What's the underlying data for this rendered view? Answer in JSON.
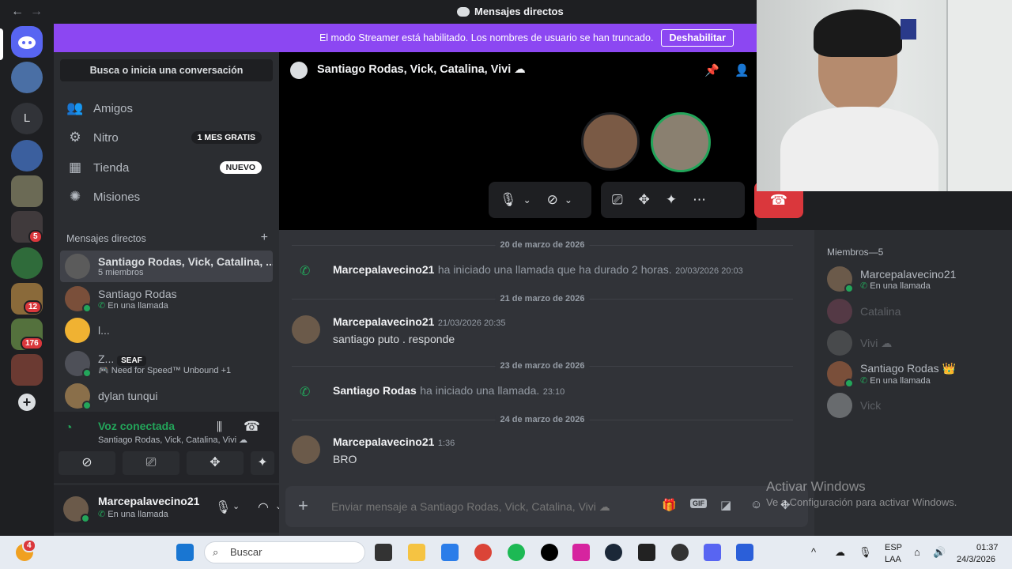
{
  "titlebar": {
    "title": "Mensajes directos",
    "back": "←",
    "forward": "→"
  },
  "banner": {
    "text": "El modo Streamer está habilitado. Los nombres de usuario se han truncado.",
    "button": "Deshabilitar"
  },
  "guilds": {
    "badges": [
      "5",
      "12",
      "176"
    ],
    "letter": "L",
    "add": "+"
  },
  "sidebar": {
    "search": "Busca o inicia una conversación",
    "nav": [
      {
        "label": "Amigos",
        "icon": "friends-icon"
      },
      {
        "label": "Nitro",
        "icon": "nitro-icon",
        "tag": "1 MES GRATIS"
      },
      {
        "label": "Tienda",
        "icon": "shop-icon",
        "tag": "NUEVO"
      },
      {
        "label": "Misiones",
        "icon": "quests-icon"
      }
    ],
    "dm_header": "Mensajes directos",
    "dm_add": "+",
    "dms": [
      {
        "name": "Santiago Rodas, Vick, Catalina, ...",
        "sub": "5 miembros"
      },
      {
        "name": "Santiago Rodas",
        "sub": "En una llamada"
      },
      {
        "name": "l...",
        "sub": ""
      },
      {
        "name": "Z...",
        "tag": "SEAF",
        "sub": "Need for Speed™ Unbound +1"
      },
      {
        "name": "dylan tunqui",
        "sub": ""
      }
    ],
    "voice": {
      "status": "Voz conectada",
      "channel": "Santiago Rodas, Vick, Catalina, Vivi ☁"
    },
    "user": {
      "name": "Marcepalavecino21",
      "status": "En una llamada"
    }
  },
  "call": {
    "title": "Santiago Rodas, Vick, Catalina, Vivi ☁"
  },
  "chat": {
    "dates": [
      "20 de marzo de 2026",
      "21 de marzo de 2026",
      "23 de marzo de 2026",
      "24 de marzo de 2026"
    ],
    "m1": {
      "name": "Marcepalavecino21",
      "text": "ha iniciado una llamada que ha durado 2 horas.",
      "ts": "20/03/2026 20:03"
    },
    "m2": {
      "name": "Marcepalavecino21",
      "ts": "21/03/2026 20:35",
      "text": "santiago puto . responde"
    },
    "m3": {
      "name": "Santiago Rodas",
      "text": "ha iniciado una llamada.",
      "ts": "23:10"
    },
    "m4": {
      "name": "Marcepalavecino21",
      "ts": "1:36",
      "text": "BRO"
    },
    "placeholder": "Enviar mensaje a Santiago Rodas, Vick, Catalina, Vivi ☁",
    "gif": "GIF"
  },
  "members": {
    "header": "Miembros—5",
    "list": [
      {
        "name": "Marcepalavecino21",
        "sub": "En una llamada"
      },
      {
        "name": "Catalina",
        "sub": ""
      },
      {
        "name": "Vivi ☁",
        "sub": ""
      },
      {
        "name": "Santiago Rodas 👑",
        "sub": "En una llamada"
      },
      {
        "name": "Vick",
        "sub": ""
      }
    ]
  },
  "watermark": {
    "title": "Activar Windows",
    "sub": "Ve a Configuración para activar Windows."
  },
  "taskbar": {
    "search": "Buscar",
    "lang1": "ESP",
    "lang2": "LAA",
    "time": "01:37",
    "date": "24/3/2026",
    "badge": "4"
  },
  "colors": {
    "accent": "#5865f2",
    "green": "#23a55a",
    "red": "#da373c",
    "banner": "#8c47f2"
  }
}
